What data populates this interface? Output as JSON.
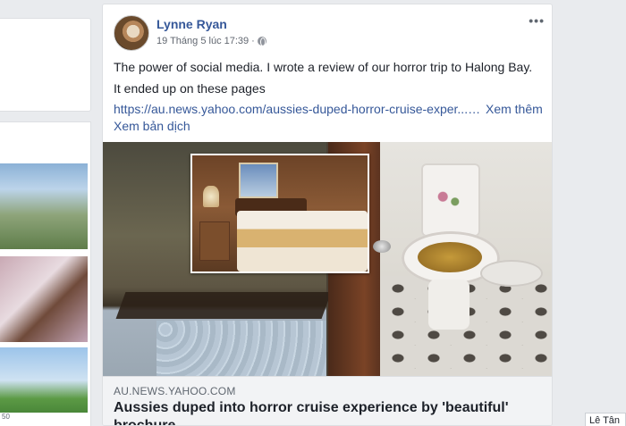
{
  "left_column": {
    "photo_caption": "50"
  },
  "post": {
    "author": "Lynne Ryan",
    "timestamp": "19 Tháng 5 lúc 17:39",
    "separator": "·",
    "body_line1": "The power of social media. I wrote a review of our horror trip to Halong Bay.",
    "body_line2": "It ended up on these pages",
    "link_text": "https://au.news.yahoo.com/aussies-duped-horror-cruise-exper...…",
    "see_more": "Xem thêm",
    "translate": "Xem bản dịch",
    "more_menu": "•••"
  },
  "link_preview": {
    "domain": "AU.NEWS.YAHOO.COM",
    "headline": "Aussies duped into horror cruise experience by 'beautiful' brochure"
  },
  "chat_sidebar": {
    "contact_name": "Lê Tân"
  },
  "icons": {
    "privacy": "globe-icon",
    "menu": "more-icon"
  },
  "colors": {
    "link": "#365899",
    "background": "#e9ebee"
  }
}
